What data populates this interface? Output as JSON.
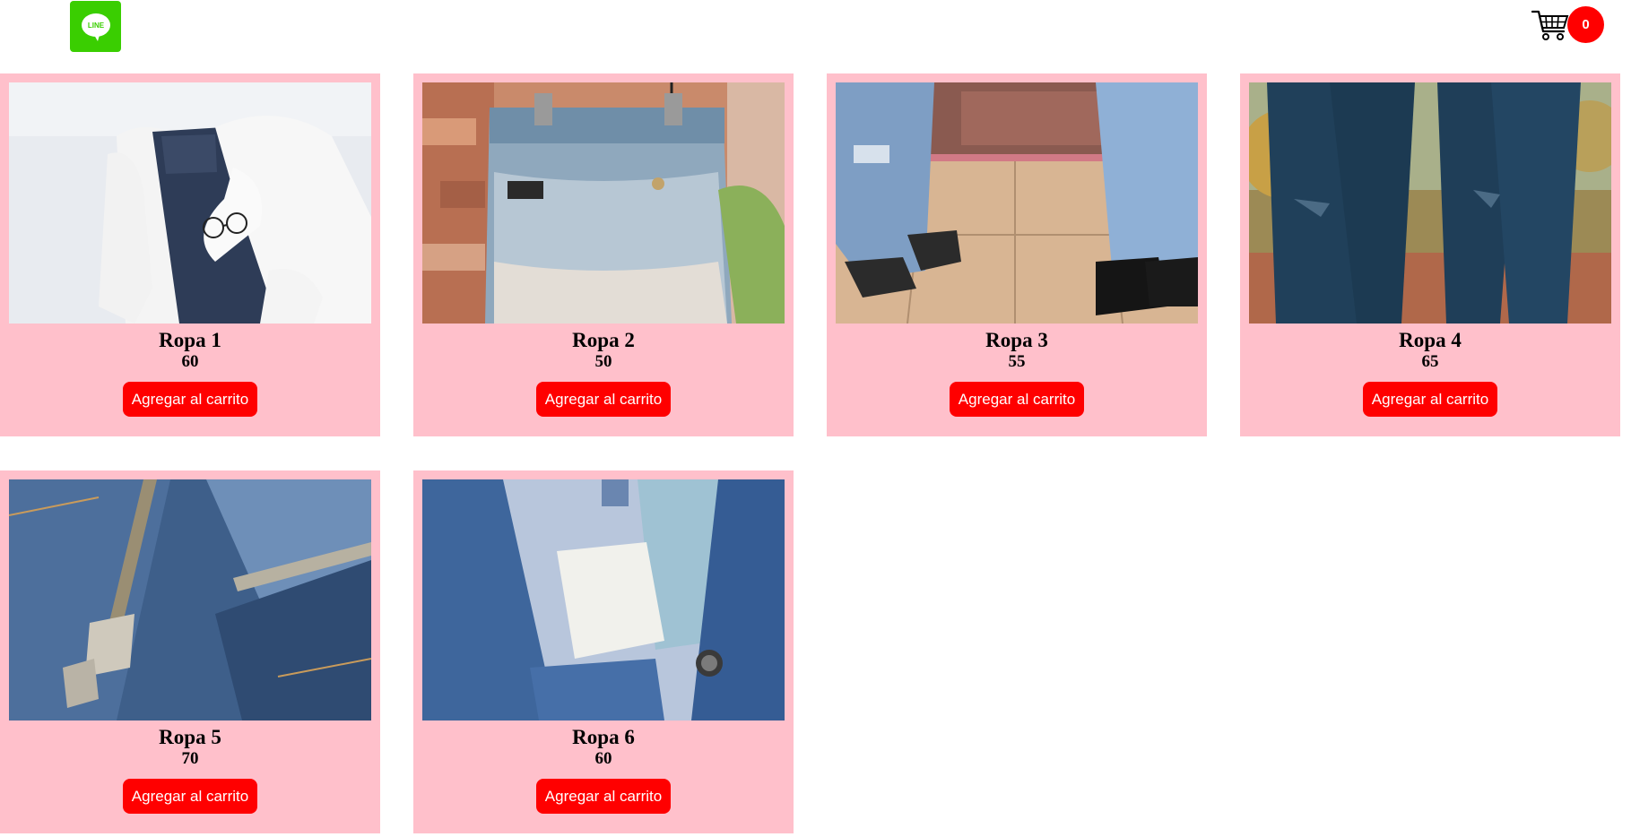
{
  "header": {
    "logo_text": "LINE",
    "logo_color": "#3ace01",
    "cart_icon": "shopping-cart-icon",
    "cart_count": "0",
    "badge_color": "#ff0000"
  },
  "products": [
    {
      "name": "Ropa 1",
      "price": "60",
      "button": "Agregar al carrito",
      "image": "white-sweater-dark-jeans-glasses-photo"
    },
    {
      "name": "Ropa 2",
      "price": "50",
      "button": "Agregar al carrito",
      "image": "hanging-acid-wash-jeans-photo"
    },
    {
      "name": "Ropa 3",
      "price": "55",
      "button": "Agregar al carrito",
      "image": "ripped-jeans-sneakers-tile-floor-photo"
    },
    {
      "name": "Ropa 4",
      "price": "65",
      "button": "Agregar al carrito",
      "image": "dark-ripped-jeans-autumn-photo"
    },
    {
      "name": "Ropa 5",
      "price": "70",
      "button": "Agregar al carrito",
      "image": "jeans-zipper-closeup-photo"
    },
    {
      "name": "Ropa 6",
      "price": "60",
      "button": "Agregar al carrito",
      "image": "denim-jacket-label-closeup-photo"
    }
  ],
  "colors": {
    "card_bg": "#ffc0cb",
    "button_bg": "#ff0000",
    "button_text": "#ffffff"
  }
}
